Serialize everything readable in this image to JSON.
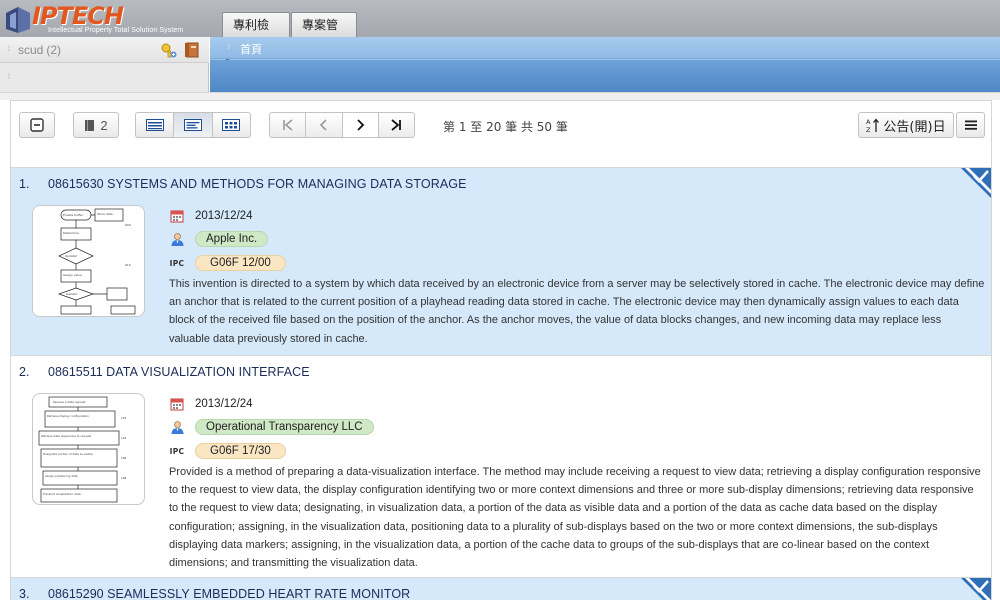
{
  "header": {
    "brand": "IPTECH",
    "tagline": "Intellectual Property Total Solution System",
    "tabs": [
      {
        "label": "專利檢索",
        "active": true
      },
      {
        "label": "專案管理",
        "active": false
      }
    ]
  },
  "sidebar": {
    "user": "scud",
    "count": "(2)",
    "key_icon": "key-icon",
    "book_icon": "book-icon"
  },
  "main_panel": {
    "title": "首頁"
  },
  "toolbar": {
    "collapse_icon": "minus-box-icon",
    "doc_count": "2",
    "view_modes": [
      "list-detail-view",
      "text-view",
      "grid-view"
    ],
    "active_view": "text-view",
    "pager": {
      "first": "first-page-icon",
      "prev": "prev-page-icon",
      "next": "next-page-icon",
      "last": "last-page-icon"
    },
    "page_info": "第 1 至 20 筆 共 50 筆",
    "sort_label": "公告(開)日",
    "menu_icon": "hamburger-icon"
  },
  "results": [
    {
      "index": "1.",
      "number": "08615630",
      "title": "SYSTEMS AND METHODS FOR MANAGING DATA STORAGE",
      "selected": true,
      "date": "2013/12/24",
      "assignee": "Apple Inc.",
      "ipc_label": "IPC",
      "ipc": "G06F 12/00",
      "abstract": "This invention is directed to a system by which data received by an electronic device from a server may be selectively stored in cache. The electronic device may define an anchor that is related to the current position of a playhead reading data stored in cache. The electronic device may then dynamically assign values to each data block of the received file based on the position of the anchor. As the anchor moves, the value of data blocks changes, and new incoming data may replace less valuable data previously stored in cache."
    },
    {
      "index": "2.",
      "number": "08615511",
      "title": "DATA VISUALIZATION INTERFACE",
      "selected": false,
      "date": "2013/12/24",
      "assignee": "Operational Transparency LLC",
      "ipc_label": "IPC",
      "ipc": "G06F 17/30",
      "abstract": "Provided is a method of preparing a data-visualization interface. The method may include receiving a request to view data; retrieving a display configuration responsive to the request to view data, the display configuration identifying two or more context dimensions and three or more sub-display dimensions; retrieving data responsive to the request to view data; designating, in visualization data, a portion of the data as visible data and a portion of the data as cache data based on the display configuration; assigning, in the visualization data, positioning data to a plurality of sub-displays based on the two or more context dimensions, the sub-displays displaying data markers; assigning, in the visualization data, a portion of the cache data to groups of the sub-displays that are co-linear based on the context dimensions; and transmitting the visualization data."
    },
    {
      "index": "3.",
      "number": "08615290",
      "title": "SEAMLESSLY EMBEDDED HEART RATE MONITOR",
      "selected": true
    }
  ]
}
